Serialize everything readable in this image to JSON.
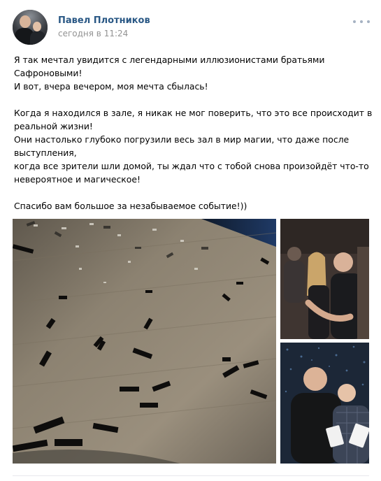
{
  "post": {
    "author": "Павел Плотников",
    "timestamp": "сегодня в 11:24",
    "text_lines": [
      "Я так мечтал увидится с легендарными иллюзионистами братьями",
      "Сафроновыми!",
      "И вот, вчера вечером, моя мечта сбылась!",
      "",
      "Когда я находился в зале, я никак не мог поверить, что это все происходит в",
      "реальной жизни!",
      "Они настолько глубоко погрузили весь зал в мир магии, что даже после",
      "выступления,",
      "когда все зрители шли домой, ты ждал что с тобой снова произойдёт что-то",
      "невероятное и магическое!",
      "",
      "Спасибо вам большое за незабываемое событие!))"
    ]
  },
  "icons": {
    "more": "more-dots-icon"
  },
  "colors": {
    "author_link": "#2a5885",
    "timestamp": "#939393",
    "divider": "#e7e8ec"
  }
}
